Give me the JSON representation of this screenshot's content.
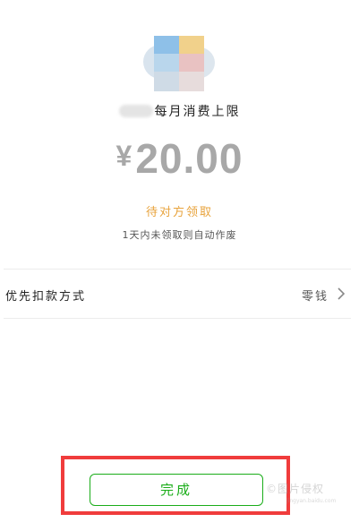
{
  "recipient": {
    "title_suffix": "每月消费上限"
  },
  "transfer": {
    "currency_symbol": "¥",
    "amount": "20.00",
    "status": "待对方领取",
    "hint": "1天内未领取则自动作废"
  },
  "payment_method": {
    "label": "优先扣款方式",
    "value": "零钱"
  },
  "actions": {
    "done_label": "完成"
  },
  "watermark": {
    "text": "©图片侵权",
    "sub": "jingyan.baidu.com"
  },
  "colors": {
    "accent_green": "#1aad19",
    "status_orange": "#e8a33c",
    "amount_gray": "#a8a8a8",
    "highlight_red": "#f03c3c"
  }
}
